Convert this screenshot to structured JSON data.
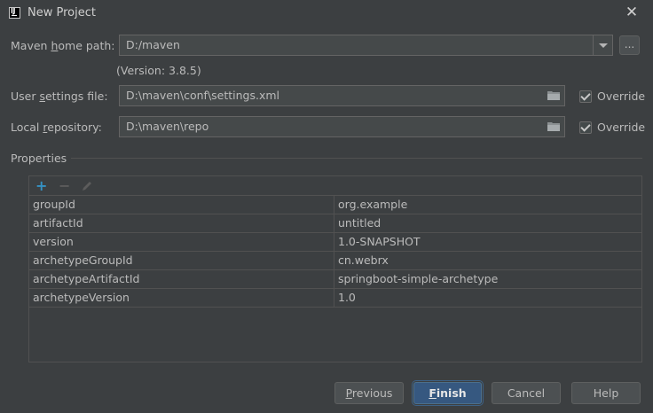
{
  "window": {
    "title": "New Project",
    "app_icon_text": "IJ"
  },
  "form": {
    "maven_home": {
      "label_pre": "Maven ",
      "label_mnemonic": "h",
      "label_post": "ome path:",
      "value": "D:/maven",
      "browse_label": "..."
    },
    "version_text": "(Version: 3.8.5)",
    "user_settings": {
      "label_pre": "User ",
      "label_mnemonic": "s",
      "label_post": "ettings file:",
      "value": "D:\\maven\\conf\\settings.xml",
      "override_label": "Override",
      "override_checked": true
    },
    "local_repo": {
      "label_pre": "Local ",
      "label_mnemonic": "r",
      "label_post": "epository:",
      "value": "D:\\maven\\repo",
      "override_label": "Override",
      "override_checked": true
    }
  },
  "properties": {
    "section_label": "Properties",
    "toolbar": {
      "add": "+",
      "remove": "−"
    },
    "rows": [
      {
        "key": "groupId",
        "value": "org.example"
      },
      {
        "key": "artifactId",
        "value": "untitled"
      },
      {
        "key": "version",
        "value": "1.0-SNAPSHOT"
      },
      {
        "key": "archetypeGroupId",
        "value": "cn.webrx"
      },
      {
        "key": "archetypeArtifactId",
        "value": "springboot-simple-archetype"
      },
      {
        "key": "archetypeVersion",
        "value": "1.0"
      }
    ]
  },
  "buttons": {
    "previous": {
      "mnemonic": "P",
      "rest": "revious"
    },
    "finish": {
      "mnemonic": "F",
      "rest": "inish"
    },
    "cancel": "Cancel",
    "help": "Help"
  },
  "colors": {
    "background": "#3c3f41",
    "field": "#45494a",
    "accent": "#365880",
    "add_icon": "#3592c4"
  }
}
